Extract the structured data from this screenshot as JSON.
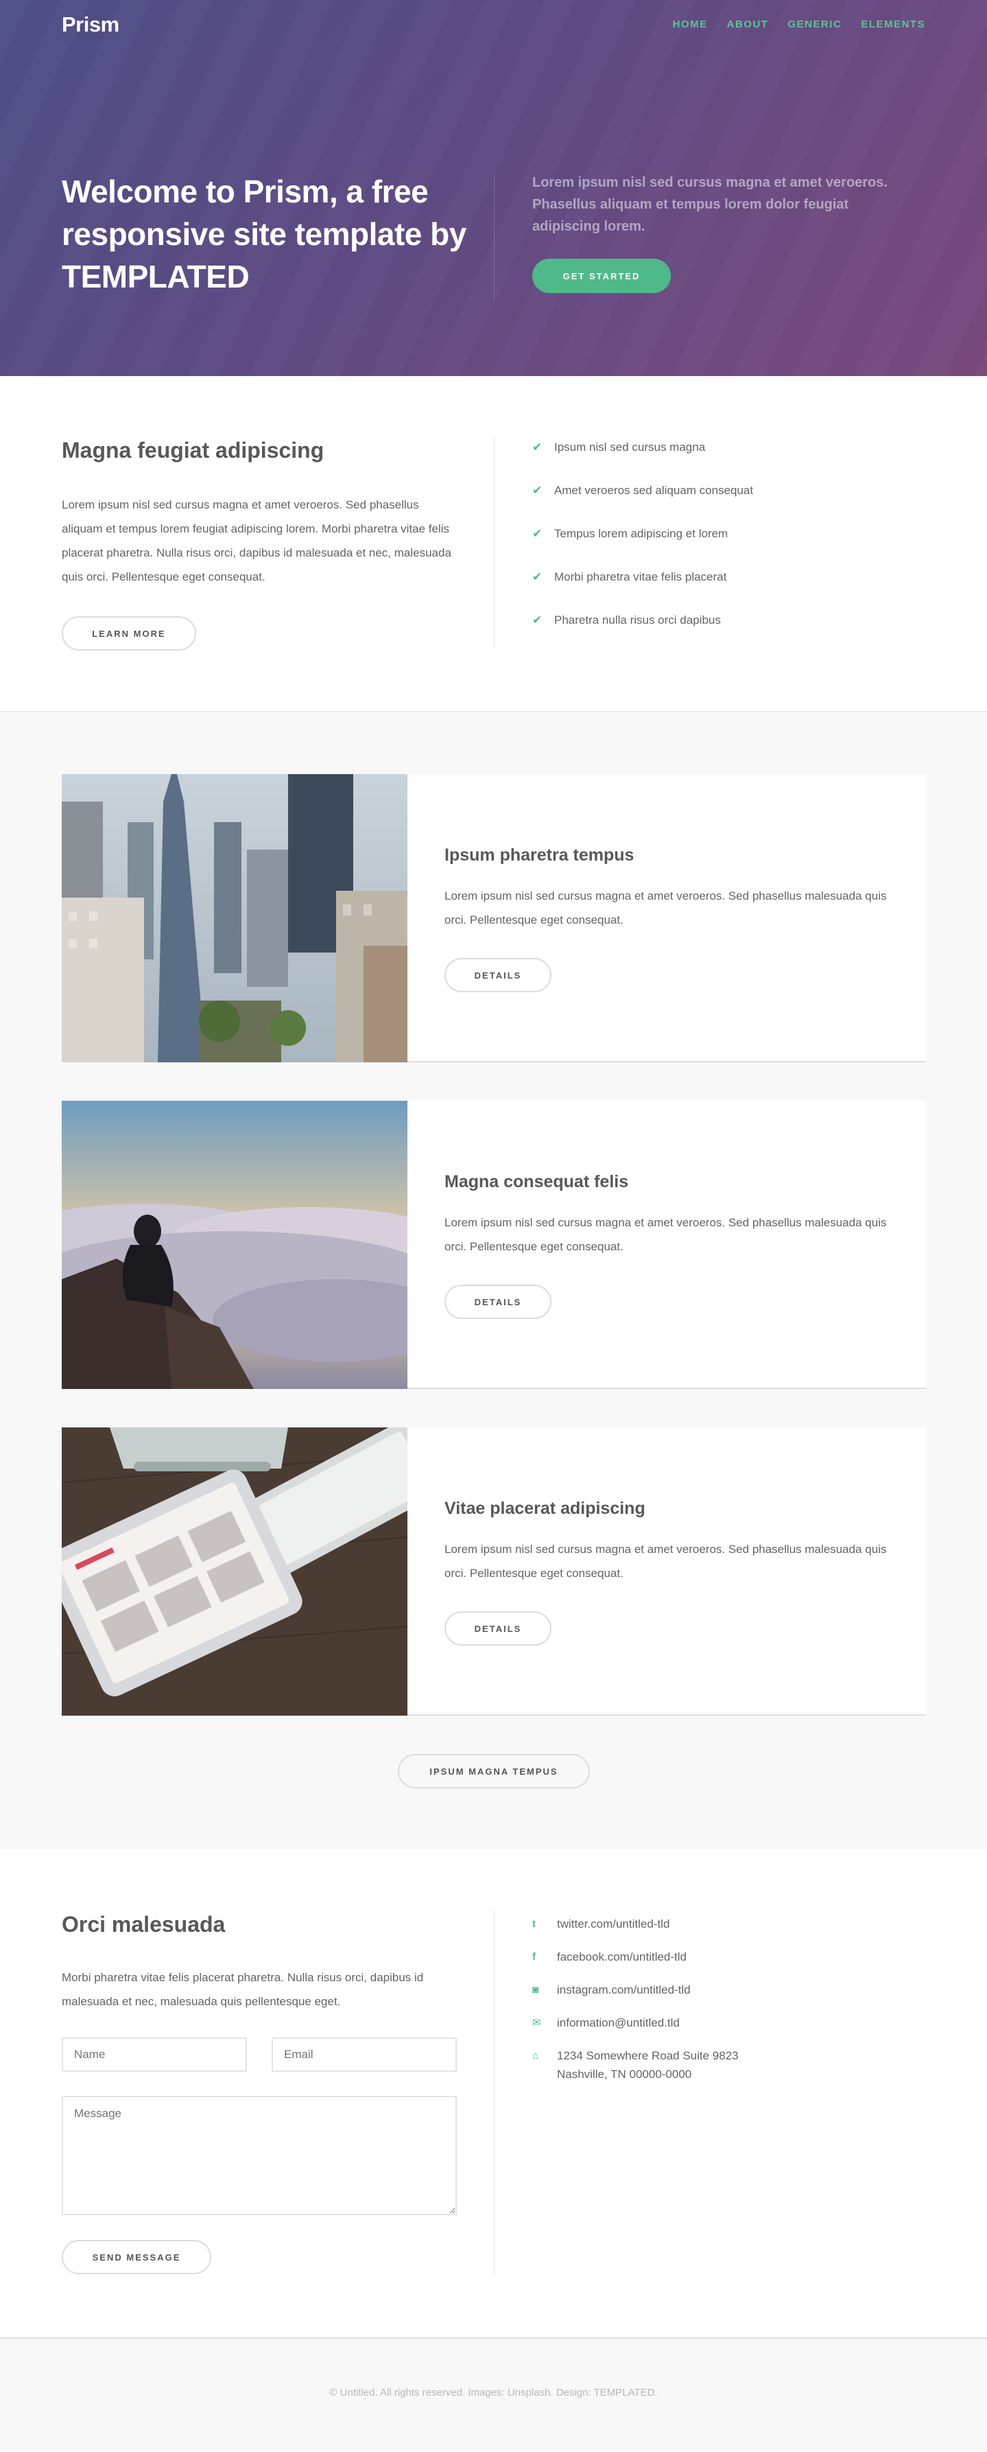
{
  "header": {
    "logo": "Prism",
    "nav": [
      "HOME",
      "ABOUT",
      "GENERIC",
      "ELEMENTS"
    ]
  },
  "banner": {
    "title": "Welcome to Prism, a free responsive site template by TEMPLATED",
    "text": "Lorem ipsum nisl sed cursus magna et amet veroeros. Phasellus aliquam et tempus lorem dolor feugiat adipiscing lorem.",
    "button": "GET STARTED"
  },
  "intro": {
    "title": "Magna feugiat adipiscing",
    "paragraph": "Lorem ipsum nisl sed cursus magna et amet veroeros. Sed phasellus aliquam et tempus lorem feugiat adipiscing lorem. Morbi pharetra vitae felis placerat pharetra. Nulla risus orci, dapibus id malesuada et nec, malesuada quis orci. Pellentesque eget consequat.",
    "button": "LEARN MORE",
    "list": [
      "Ipsum nisl sed cursus magna",
      "Amet veroeros sed aliquam consequat",
      "Tempus lorem adipiscing et lorem",
      "Morbi pharetra vitae felis placerat",
      "Pharetra nulla risus orci dapibus"
    ],
    "check_icon": "check-icon"
  },
  "cards": [
    {
      "image": "city-skyline-photo",
      "title": "Ipsum pharetra tempus",
      "text": "Lorem ipsum nisl sed cursus magna et amet veroeros. Sed phasellus malesuada quis orci. Pellentesque eget consequat.",
      "button": "DETAILS"
    },
    {
      "image": "man-above-clouds-photo",
      "title": "Magna consequat felis",
      "text": "Lorem ipsum nisl sed cursus magna et amet veroeros. Sed phasellus malesuada quis orci. Pellentesque eget consequat.",
      "button": "DETAILS"
    },
    {
      "image": "tablet-keyboard-photo",
      "title": "Vitae placerat adipiscing",
      "text": "Lorem ipsum nisl sed cursus magna et amet veroeros. Sed phasellus malesuada quis orci. Pellentesque eget consequat.",
      "button": "DETAILS"
    }
  ],
  "more_button": "IPSUM MAGNA TEMPUS",
  "contact": {
    "title": "Orci malesuada",
    "paragraph": "Morbi pharetra vitae felis placerat pharetra. Nulla risus orci, dapibus id malesuada et nec, malesuada quis pellentesque eget.",
    "name_placeholder": "Name",
    "email_placeholder": "Email",
    "message_placeholder": "Message",
    "button": "SEND MESSAGE",
    "links": [
      {
        "icon": "twitter-icon",
        "glyph": "t",
        "text": "twitter.com/untitled-tld"
      },
      {
        "icon": "facebook-icon",
        "glyph": "f",
        "text": "facebook.com/untitled-tld"
      },
      {
        "icon": "instagram-icon",
        "glyph": "◙",
        "text": "instagram.com/untitled-tld"
      },
      {
        "icon": "envelope-icon",
        "glyph": "✉",
        "text": "information@untitled.tld"
      },
      {
        "icon": "home-icon",
        "glyph": "⌂",
        "text": "1234 Somewhere Road Suite 9823",
        "text2": "Nashville, TN 00000-0000"
      }
    ]
  },
  "footer": {
    "text": "© Untitled. All rights reserved. Images: Unsplash. Design: TEMPLATED."
  },
  "colors": {
    "accent": "#4fb98a",
    "banner_start": "#4d4f86",
    "banner_end": "#7a4a7e"
  }
}
